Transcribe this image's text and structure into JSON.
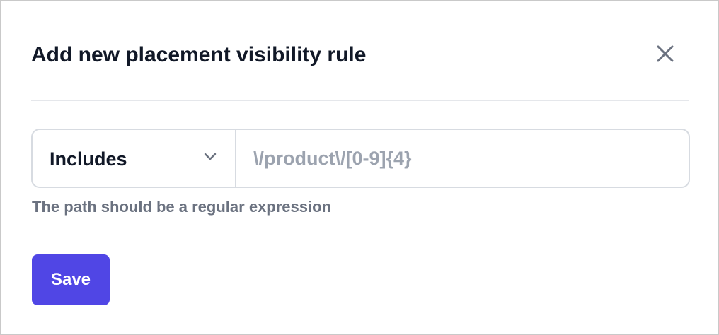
{
  "modal": {
    "title": "Add new placement visibility rule",
    "close_icon": "close-icon"
  },
  "rule": {
    "operator": {
      "selected": "Includes",
      "icon": "chevron-down-icon"
    },
    "path": {
      "value": "",
      "placeholder": "\\/product\\/[0-9]{4}"
    },
    "helper_text": "The path should be a regular expression"
  },
  "actions": {
    "save_label": "Save"
  },
  "colors": {
    "primary": "#5046e5",
    "text": "#111827",
    "muted": "#6b7280",
    "placeholder": "#9ca3af",
    "border": "#d7dbe1"
  }
}
